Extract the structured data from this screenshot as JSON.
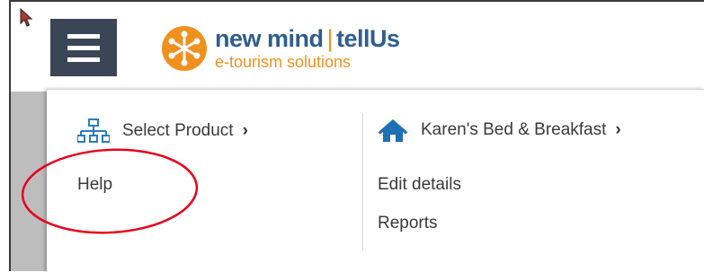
{
  "header": {
    "menu_icon": "hamburger-menu-icon",
    "logo": {
      "brand_left": "new mind",
      "separator": "|",
      "brand_right": "tellUs",
      "tagline": "e-tourism solutions",
      "mark_icon": "asterisk-flower-icon"
    },
    "colors": {
      "menu_bg": "#3a4655",
      "brand_blue": "#2f5e8d",
      "brand_orange": "#f0901e"
    }
  },
  "menu": {
    "left_column": {
      "heading": {
        "icon": "network-sitemap-icon",
        "label": "Select Product",
        "chevron": "›"
      },
      "items": [
        {
          "label": "Help"
        }
      ]
    },
    "right_column": {
      "heading": {
        "icon": "home-icon",
        "label": "Karen's Bed & Breakfast",
        "chevron": "›"
      },
      "items": [
        {
          "label": "Edit details"
        },
        {
          "label": "Reports"
        }
      ]
    }
  },
  "annotation": {
    "shape": "ellipse",
    "color": "#e8001c"
  }
}
